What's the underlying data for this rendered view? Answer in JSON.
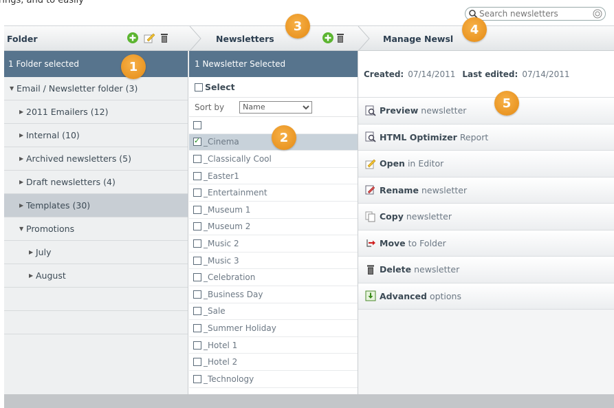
{
  "caption": "rings, and to easily",
  "search": {
    "placeholder": "Search newsletters"
  },
  "header": {
    "folder_title": "Folder",
    "newsletters_title": "Newsletters",
    "manage_title": "Manage Newsl"
  },
  "folders": {
    "banner": "1 Folder selected",
    "items": [
      {
        "label": "Email / Newsletter folder (3)",
        "expanded": true
      },
      {
        "label": "2011 Emailers (12)"
      },
      {
        "label": "Internal (10)"
      },
      {
        "label": "Archived newsletters (5)"
      },
      {
        "label": "Draft newsletters (4)"
      },
      {
        "label": "Templates (30)",
        "selected": true
      },
      {
        "label": "Promotions",
        "expanded": true
      },
      {
        "label": "July"
      },
      {
        "label": "August"
      }
    ]
  },
  "newsletters": {
    "banner": "1 Newsletter Selected",
    "select_label": "Select",
    "sort_label": "Sort by",
    "sort_value": "Name",
    "items": [
      {
        "label": "",
        "checked": false
      },
      {
        "label": "_Cinema",
        "checked": true
      },
      {
        "label": "_Classically Cool",
        "checked": false
      },
      {
        "label": "_Easter1",
        "checked": false
      },
      {
        "label": "_Entertainment",
        "checked": false
      },
      {
        "label": "_Museum 1",
        "checked": false
      },
      {
        "label": "_Museum 2",
        "checked": false
      },
      {
        "label": "_Music 2",
        "checked": false
      },
      {
        "label": "_Music 3",
        "checked": false
      },
      {
        "label": "_Celebration",
        "checked": false
      },
      {
        "label": "_Business Day",
        "checked": false
      },
      {
        "label": "_Sale",
        "checked": false
      },
      {
        "label": "_Summer Holiday",
        "checked": false
      },
      {
        "label": "_Hotel 1",
        "checked": false
      },
      {
        "label": "_Hotel 2",
        "checked": false
      },
      {
        "label": "_Technology",
        "checked": false
      }
    ]
  },
  "manage": {
    "created_label": "Created:",
    "created_value": "07/14/2011",
    "edited_label": "Last edited:",
    "edited_value": "07/14/2011",
    "actions": [
      {
        "bold": "Preview",
        "rest": "newsletter",
        "icon": "preview-icon"
      },
      {
        "bold": "HTML Optimizer",
        "rest": "Report",
        "icon": "optimizer-icon"
      },
      {
        "bold": "Open",
        "rest": "in Editor",
        "icon": "edit-icon"
      },
      {
        "bold": "Rename",
        "rest": "newsletter",
        "icon": "rename-icon"
      },
      {
        "bold": "Copy",
        "rest": "newsletter",
        "icon": "copy-icon"
      },
      {
        "bold": "Move",
        "rest": "to Folder",
        "icon": "move-icon"
      },
      {
        "bold": "Delete",
        "rest": "newsletter",
        "icon": "trash-icon"
      },
      {
        "bold": "Advanced",
        "rest": "options",
        "icon": "advanced-icon"
      }
    ]
  },
  "callouts": [
    "1",
    "2",
    "3",
    "4",
    "5"
  ],
  "colors": {
    "accent": "#57748d",
    "callout": "#f0a030",
    "selected_row": "#c8ced4"
  }
}
